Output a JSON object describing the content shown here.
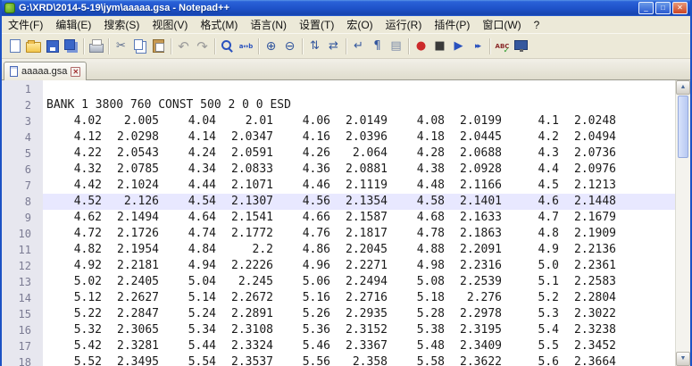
{
  "window": {
    "title": "G:\\XRD\\2014-5-19\\jym\\aaaaa.gsa - Notepad++",
    "controls": {
      "minimize": "_",
      "maximize": "□",
      "close": "✕"
    }
  },
  "menu": {
    "items": [
      "文件(F)",
      "编辑(E)",
      "搜索(S)",
      "视图(V)",
      "格式(M)",
      "语言(N)",
      "设置(T)",
      "宏(O)",
      "运行(R)",
      "插件(P)",
      "窗口(W)",
      "?"
    ]
  },
  "toolbar": {
    "icons": [
      {
        "name": "new-file"
      },
      {
        "name": "open-file"
      },
      {
        "name": "save"
      },
      {
        "name": "save-all"
      },
      {
        "name": "separator"
      },
      {
        "name": "print"
      },
      {
        "name": "separator"
      },
      {
        "name": "cut",
        "glyph": "✂",
        "color": "#5a6b8c"
      },
      {
        "name": "copy"
      },
      {
        "name": "paste"
      },
      {
        "name": "separator"
      },
      {
        "name": "undo",
        "glyph": "↶",
        "color": "#9a9a9a"
      },
      {
        "name": "redo",
        "glyph": "↷",
        "color": "#9a9a9a"
      },
      {
        "name": "separator"
      },
      {
        "name": "find"
      },
      {
        "name": "replace",
        "glyph": "a↔b",
        "color": "#2a52be"
      },
      {
        "name": "separator"
      },
      {
        "name": "zoom-in",
        "glyph": "⊕",
        "color": "#35589e"
      },
      {
        "name": "zoom-out",
        "glyph": "⊖",
        "color": "#35589e"
      },
      {
        "name": "separator"
      },
      {
        "name": "sync-vertical",
        "glyph": "⇅",
        "color": "#35589e"
      },
      {
        "name": "sync-horizontal",
        "glyph": "⇄",
        "color": "#35589e"
      },
      {
        "name": "separator"
      },
      {
        "name": "word-wrap",
        "glyph": "↵",
        "color": "#35589e"
      },
      {
        "name": "show-all-chars",
        "glyph": "¶",
        "color": "#35589e"
      },
      {
        "name": "indent-guide",
        "glyph": "▤",
        "color": "#7a8aa8"
      },
      {
        "name": "separator"
      },
      {
        "name": "record-macro",
        "glyph": "●",
        "color": "#cc2a2a"
      },
      {
        "name": "stop-macro",
        "glyph": "■",
        "color": "#3a3a3a"
      },
      {
        "name": "play-macro",
        "glyph": "▶",
        "color": "#2a52be"
      },
      {
        "name": "run-macro-multiple",
        "glyph": "▸▸",
        "color": "#2a52be"
      },
      {
        "name": "separator"
      },
      {
        "name": "spell-check",
        "glyph": "ABC",
        "color": "#8a2a2a"
      },
      {
        "name": "doc-monitor"
      }
    ]
  },
  "tab": {
    "label": "aaaaa.gsa",
    "close": "✕"
  },
  "scrollbar": {
    "up": "▲",
    "down": "▼"
  },
  "editor": {
    "lines": [
      {
        "n": "1"
      },
      {
        "n": "2",
        "text": "BANK 1 3800 760 CONST 500 2 0 0 ESD"
      },
      {
        "n": "3",
        "cells": [
          "4.02",
          "2.005",
          "4.04",
          "2.01",
          "4.06",
          "2.0149",
          "4.08",
          "2.0199",
          "4.1",
          "2.0248"
        ]
      },
      {
        "n": "4",
        "cells": [
          "4.12",
          "2.0298",
          "4.14",
          "2.0347",
          "4.16",
          "2.0396",
          "4.18",
          "2.0445",
          "4.2",
          "2.0494"
        ]
      },
      {
        "n": "5",
        "cells": [
          "4.22",
          "2.0543",
          "4.24",
          "2.0591",
          "4.26",
          "2.064",
          "4.28",
          "2.0688",
          "4.3",
          "2.0736"
        ]
      },
      {
        "n": "6",
        "cells": [
          "4.32",
          "2.0785",
          "4.34",
          "2.0833",
          "4.36",
          "2.0881",
          "4.38",
          "2.0928",
          "4.4",
          "2.0976"
        ]
      },
      {
        "n": "7",
        "cells": [
          "4.42",
          "2.1024",
          "4.44",
          "2.1071",
          "4.46",
          "2.1119",
          "4.48",
          "2.1166",
          "4.5",
          "2.1213"
        ]
      },
      {
        "n": "8",
        "current": true,
        "cells": [
          "4.52",
          "2.126",
          "4.54",
          "2.1307",
          "4.56",
          "2.1354",
          "4.58",
          "2.1401",
          "4.6",
          "2.1448"
        ]
      },
      {
        "n": "9",
        "cells": [
          "4.62",
          "2.1494",
          "4.64",
          "2.1541",
          "4.66",
          "2.1587",
          "4.68",
          "2.1633",
          "4.7",
          "2.1679"
        ]
      },
      {
        "n": "10",
        "cells": [
          "4.72",
          "2.1726",
          "4.74",
          "2.1772",
          "4.76",
          "2.1817",
          "4.78",
          "2.1863",
          "4.8",
          "2.1909"
        ]
      },
      {
        "n": "11",
        "cells": [
          "4.82",
          "2.1954",
          "4.84",
          "2.2",
          "4.86",
          "2.2045",
          "4.88",
          "2.2091",
          "4.9",
          "2.2136"
        ]
      },
      {
        "n": "12",
        "cells": [
          "4.92",
          "2.2181",
          "4.94",
          "2.2226",
          "4.96",
          "2.2271",
          "4.98",
          "2.2316",
          "5.0",
          "2.2361"
        ]
      },
      {
        "n": "13",
        "cells": [
          "5.02",
          "2.2405",
          "5.04",
          "2.245",
          "5.06",
          "2.2494",
          "5.08",
          "2.2539",
          "5.1",
          "2.2583"
        ]
      },
      {
        "n": "14",
        "cells": [
          "5.12",
          "2.2627",
          "5.14",
          "2.2672",
          "5.16",
          "2.2716",
          "5.18",
          "2.276",
          "5.2",
          "2.2804"
        ]
      },
      {
        "n": "15",
        "cells": [
          "5.22",
          "2.2847",
          "5.24",
          "2.2891",
          "5.26",
          "2.2935",
          "5.28",
          "2.2978",
          "5.3",
          "2.3022"
        ]
      },
      {
        "n": "16",
        "cells": [
          "5.32",
          "2.3065",
          "5.34",
          "2.3108",
          "5.36",
          "2.3152",
          "5.38",
          "2.3195",
          "5.4",
          "2.3238"
        ]
      },
      {
        "n": "17",
        "cells": [
          "5.42",
          "2.3281",
          "5.44",
          "2.3324",
          "5.46",
          "2.3367",
          "5.48",
          "2.3409",
          "5.5",
          "2.3452"
        ]
      },
      {
        "n": "18",
        "cells": [
          "5.52",
          "2.3495",
          "5.54",
          "2.3537",
          "5.56",
          "2.358",
          "5.58",
          "2.3622",
          "5.6",
          "2.3664"
        ]
      }
    ]
  }
}
